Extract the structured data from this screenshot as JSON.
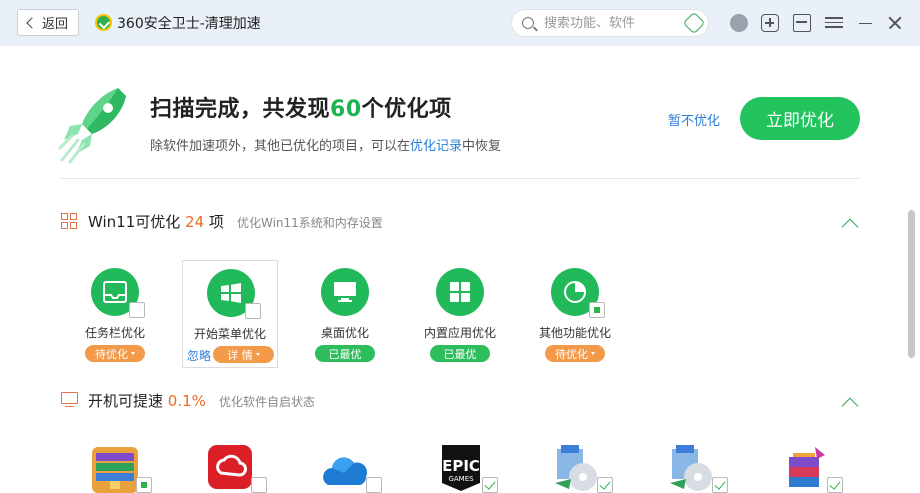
{
  "titlebar": {
    "back_label": "返回",
    "app_title": "360安全卫士-清理加速",
    "search_placeholder": "搜索功能、软件"
  },
  "header": {
    "headline_prefix": "扫描完成，共发现",
    "headline_count": "60",
    "headline_suffix": "个优化项",
    "sub_prefix": "除软件加速项外，其他已优化的项目，可以在",
    "sub_link": "优化记录",
    "sub_suffix": "中恢复",
    "skip_label": "暂不优化",
    "optimize_label": "立即优化"
  },
  "win11": {
    "title": "Win11可优化",
    "count": "24",
    "unit": "项",
    "desc": "优化Win11系统和内存设置",
    "items": [
      {
        "label": "任务栏优化",
        "status": "待优化",
        "icon": "taskbar-icon"
      },
      {
        "label": "开始菜单优化",
        "status": "详 情",
        "ignore": "忽略",
        "icon": "windows-icon"
      },
      {
        "label": "桌面优化",
        "status": "已最优",
        "icon": "desktop-icon"
      },
      {
        "label": "内置应用优化",
        "status": "已最优",
        "icon": "apps-grid-icon"
      },
      {
        "label": "其他功能优化",
        "status": "待优化",
        "icon": "pie-chart-icon"
      }
    ]
  },
  "startup": {
    "title": "开机可提速",
    "percent": "0.1%",
    "desc": "优化软件自启状态",
    "apps": [
      {
        "icon": "archive-app-icon"
      },
      {
        "icon": "adobe-creative-cloud-icon"
      },
      {
        "icon": "onedrive-icon"
      },
      {
        "icon": "epic-games-icon",
        "logo_text": "EPIC GAMES"
      },
      {
        "icon": "installer-disc-icon"
      },
      {
        "icon": "installer-disc-icon"
      },
      {
        "icon": "winrar-icon"
      }
    ]
  },
  "colors": {
    "accent_green": "#22c25c",
    "link_blue": "#2b7fd6",
    "warning_orange": "#f39a4a",
    "count_orange": "#ec6a2a"
  }
}
